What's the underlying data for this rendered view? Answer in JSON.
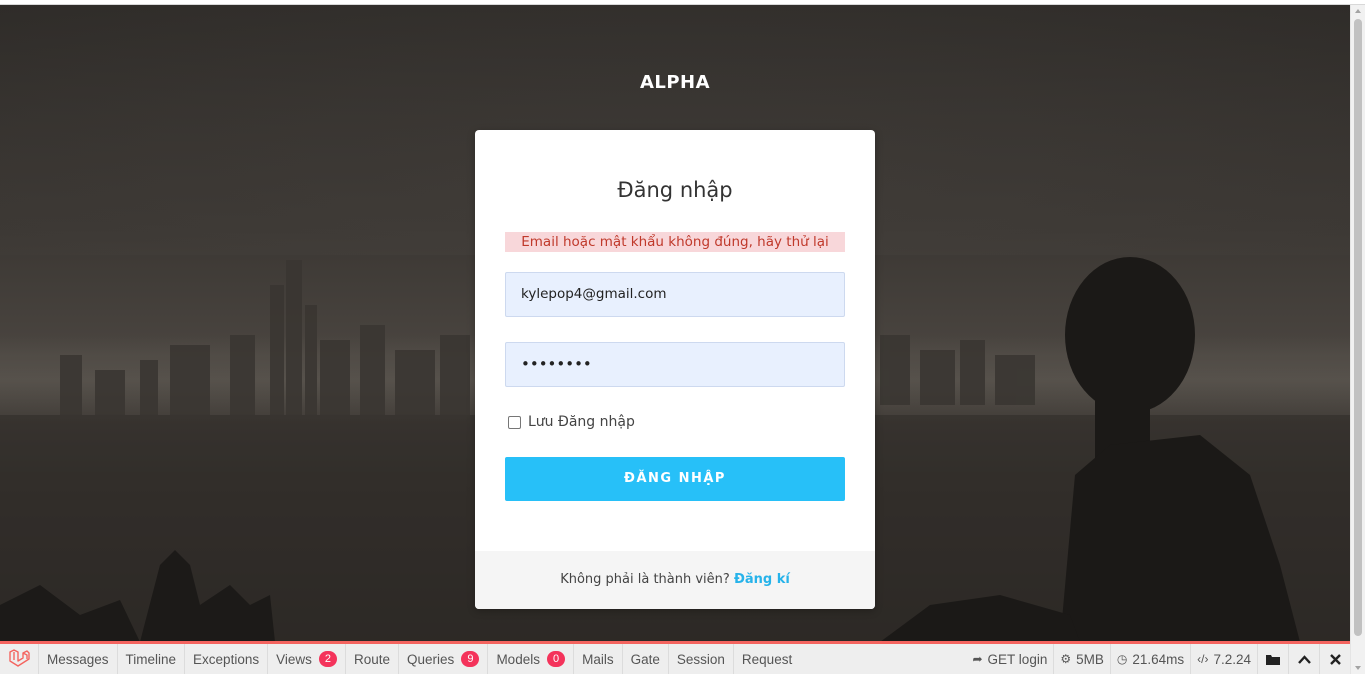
{
  "brand": "ALPHA",
  "login": {
    "title": "Đăng nhập",
    "error": "Email hoặc mật khẩu không đúng, hãy thử lại",
    "email_value": "kylepop4@gmail.com",
    "password_value": "••••••••",
    "remember_label": "Lưu Đăng nhập",
    "submit_label": "ĐĂNG NHẬP",
    "footer_text": "Không phải là thành viên?",
    "register_link": "Đăng kí"
  },
  "debugbar": {
    "tabs": [
      {
        "label": "Messages"
      },
      {
        "label": "Timeline"
      },
      {
        "label": "Exceptions"
      },
      {
        "label": "Views",
        "badge": "2"
      },
      {
        "label": "Route"
      },
      {
        "label": "Queries",
        "badge": "9"
      },
      {
        "label": "Models",
        "badge": "0"
      },
      {
        "label": "Mails"
      },
      {
        "label": "Gate"
      },
      {
        "label": "Session"
      },
      {
        "label": "Request"
      }
    ],
    "request": "GET login",
    "memory": "5MB",
    "time": "21.64ms",
    "php_version": "7.2.24"
  },
  "colors": {
    "accent": "#27c0f8",
    "alert_bg": "#f8d7da",
    "alert_text": "#c0392b",
    "debugbar_accent": "#f4645f",
    "badge": "#f4335b"
  }
}
